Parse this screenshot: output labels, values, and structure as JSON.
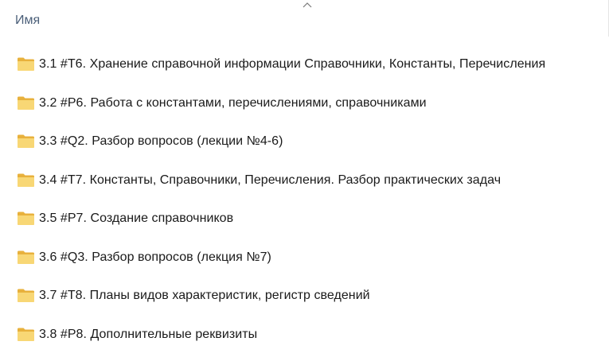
{
  "header": {
    "name_column": "Имя",
    "sort_icon": "chevron-up-icon"
  },
  "items": [
    {
      "label": "3.1 #T6. Хранение справочной информации Справочники, Константы, Перечисления",
      "icon": "folder-icon"
    },
    {
      "label": "3.2 #P6. Работа с константами, перечислениями, справочниками",
      "icon": "folder-icon"
    },
    {
      "label": "3.3 #Q2. Разбор вопросов (лекции №4-6)",
      "icon": "folder-icon"
    },
    {
      "label": "3.4 #T7. Константы, Справочники, Перечисления. Разбор практических задач",
      "icon": "folder-icon"
    },
    {
      "label": "3.5 #P7. Создание справочников",
      "icon": "folder-icon"
    },
    {
      "label": "3.6 #Q3. Разбор вопросов (лекция №7)",
      "icon": "folder-icon"
    },
    {
      "label": "3.7 #T8. Планы видов характеристик, регистр сведений",
      "icon": "folder-icon"
    },
    {
      "label": "3.8 #P8. Дополнительные реквизиты",
      "icon": "folder-icon"
    }
  ],
  "colors": {
    "folder_body": "#f8d775",
    "folder_back": "#e8b13c",
    "header_text": "#4c607a",
    "item_text": "#1a1a1a"
  }
}
